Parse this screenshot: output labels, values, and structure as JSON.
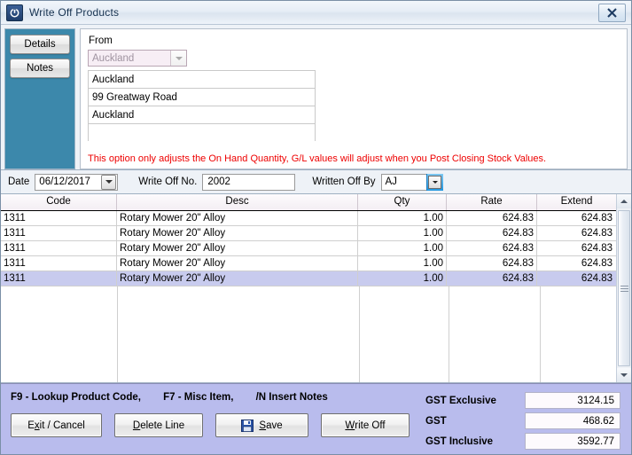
{
  "window": {
    "title": "Write Off Products",
    "icon": "power-icon",
    "close_label": "✕"
  },
  "sidebar": {
    "buttons": [
      {
        "label": "Details",
        "name": "details"
      },
      {
        "label": "Notes",
        "name": "notes"
      }
    ]
  },
  "from_panel": {
    "legend": "From",
    "branch_combo": {
      "value": "Auckland",
      "placeholder": "Auckland"
    },
    "address_lines": [
      "Auckland",
      "99 Greatway Road",
      "Auckland",
      ""
    ],
    "warning": "This option only adjusts the On Hand Quantity, G/L values will adjust when you Post Closing Stock Values.",
    "warning_color": "#ee0000"
  },
  "form": {
    "date_label": "Date",
    "date_value": "06/12/2017",
    "write_off_no_label": "Write Off No.",
    "write_off_no_value": "2002",
    "written_off_by_label": "Written Off By",
    "written_off_by_value": "AJ",
    "focus_color": "#2196e0"
  },
  "grid": {
    "columns": [
      "Code",
      "Desc",
      "Qty",
      "Rate",
      "Extend"
    ],
    "rows": [
      {
        "code": "1311",
        "desc": "Rotary Mower 20\" Alloy",
        "qty": "1.00",
        "rate": "624.83",
        "extend": "624.83",
        "selected": false
      },
      {
        "code": "1311",
        "desc": "Rotary Mower 20\" Alloy",
        "qty": "1.00",
        "rate": "624.83",
        "extend": "624.83",
        "selected": false
      },
      {
        "code": "1311",
        "desc": "Rotary Mower 20\" Alloy",
        "qty": "1.00",
        "rate": "624.83",
        "extend": "624.83",
        "selected": false
      },
      {
        "code": "1311",
        "desc": "Rotary Mower 20\" Alloy",
        "qty": "1.00",
        "rate": "624.83",
        "extend": "624.83",
        "selected": false
      },
      {
        "code": "1311",
        "desc": "Rotary Mower 20\" Alloy",
        "qty": "1.00",
        "rate": "624.83",
        "extend": "624.83",
        "selected": true
      }
    ],
    "selection_color": "#c8cbee"
  },
  "footer": {
    "background": "#b9bced",
    "hints": [
      "F9 - Lookup Product Code,",
      "F7 - Misc Item,",
      "/N Insert Notes"
    ],
    "buttons": [
      {
        "name": "exit-cancel",
        "label": "Exit / Cancel",
        "accel": "x"
      },
      {
        "name": "delete-line",
        "label": "Delete Line",
        "accel": "D"
      },
      {
        "name": "save",
        "label": "Save",
        "accel": "S",
        "icon": "floppy-disk-icon"
      },
      {
        "name": "write-off",
        "label": "Write Off",
        "accel": "W"
      }
    ],
    "totals": [
      {
        "label": "GST Exclusive",
        "value": "3124.15"
      },
      {
        "label": "GST",
        "value": "468.62"
      },
      {
        "label": "GST Inclusive",
        "value": "3592.77"
      }
    ]
  }
}
